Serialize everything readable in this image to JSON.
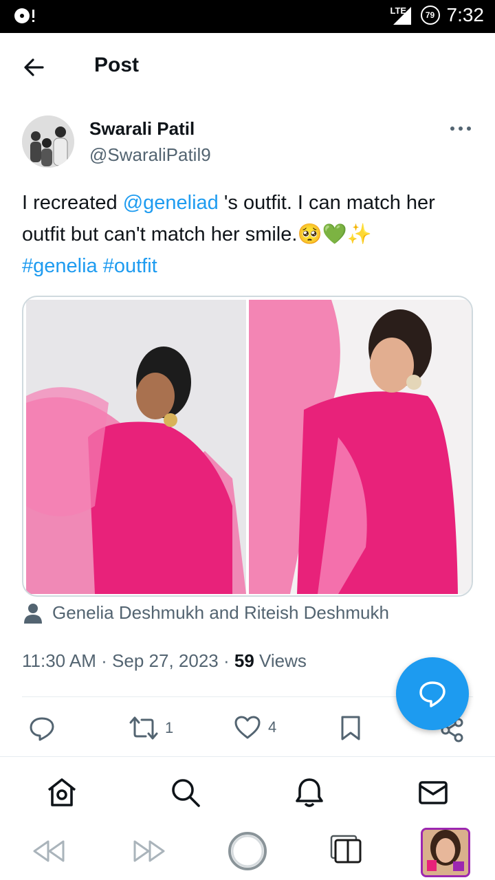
{
  "status_bar": {
    "network": "LTE",
    "battery": "79",
    "time": "7:32"
  },
  "header": {
    "title": "Post"
  },
  "tweet": {
    "author_name": "Swarali Patil",
    "author_handle": "@SwaraliPatil9",
    "text_part1": "I recreated ",
    "mention": "@geneliad",
    "text_part2": " 's outfit. I can match her outfit but can't match her smile.",
    "emojis": "🥺💚✨",
    "hashtag1": "#genelia",
    "hashtag2": "#outfit",
    "tagged": "Genelia Deshmukh and Riteish Deshmukh",
    "time": "11:30 AM",
    "date": "Sep 27, 2023",
    "views_count": "59",
    "views_label": "Views",
    "retweets": "1",
    "likes": "4"
  },
  "colors": {
    "link": "#1d9bf0",
    "fab": "#1d9bf0",
    "outfit_pink": "#e8227a"
  },
  "icons": {
    "back": "arrow-left-icon",
    "more": "more-icon",
    "reply": "reply-icon",
    "retweet": "retweet-icon",
    "like": "heart-icon",
    "bookmark": "bookmark-icon",
    "share": "share-icon",
    "fab": "compose-icon",
    "home": "home-icon",
    "search": "search-icon",
    "notifications": "bell-icon",
    "messages": "mail-icon"
  }
}
